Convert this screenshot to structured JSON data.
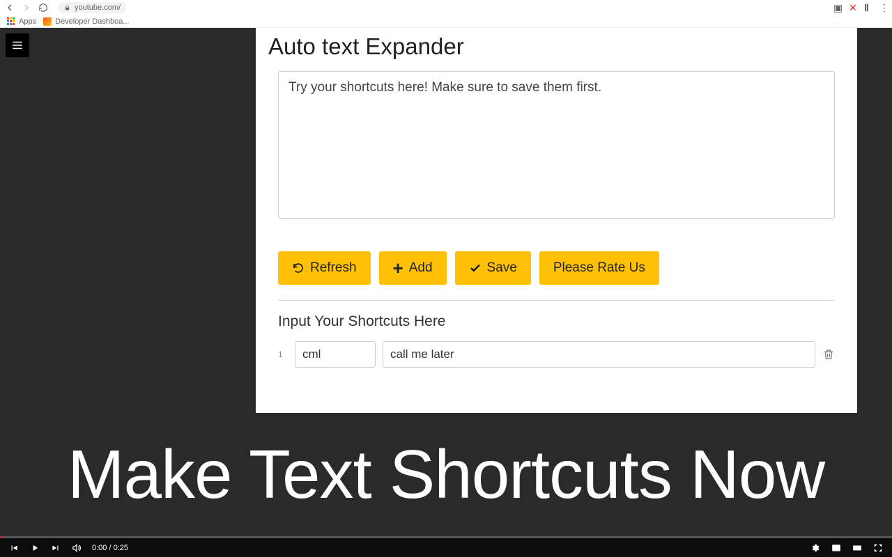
{
  "chrome": {
    "url": "youtube.com/",
    "apps_label": "Apps",
    "bookmark1": "Developer Dashboa..."
  },
  "panel": {
    "title": "Auto text Expander",
    "try_placeholder": "Try your shortcuts here! Make sure to save them first.",
    "buttons": {
      "refresh": "Refresh",
      "add": "Add",
      "save": "Save",
      "rate": "Please Rate Us"
    },
    "input_heading": "Input Your Shortcuts Here",
    "rows": [
      {
        "num": "1",
        "short": "cml",
        "long": "call me later"
      }
    ]
  },
  "overlay_text": "Make Text Shortcuts Now",
  "video": {
    "time": "0:00 / 0:25"
  }
}
